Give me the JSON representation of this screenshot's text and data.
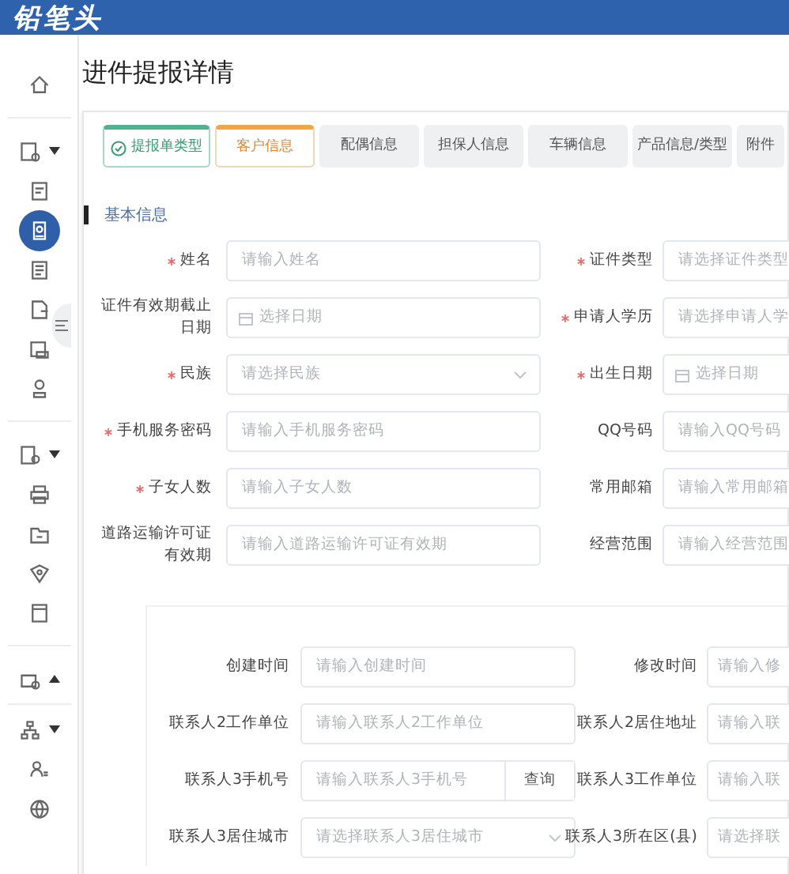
{
  "header": {
    "logo": "铅笔头"
  },
  "sidebar": {
    "groups": [
      {
        "items": [
          {
            "selected": false
          }
        ]
      },
      {
        "items": [
          {
            "selected": false,
            "expanded": false
          },
          {
            "selected": false
          },
          {
            "selected": true
          },
          {
            "selected": false
          },
          {
            "selected": false
          },
          {
            "selected": false
          },
          {
            "selected": false
          }
        ]
      },
      {
        "items": [
          {
            "selected": false,
            "expanded": false
          },
          {
            "selected": false
          },
          {
            "selected": false
          },
          {
            "selected": false
          },
          {
            "selected": false
          }
        ]
      },
      {
        "items": [
          {
            "selected": false,
            "expanded": true
          }
        ]
      },
      {
        "items": [
          {
            "selected": false,
            "expanded": false
          },
          {
            "selected": false
          },
          {
            "selected": false
          }
        ]
      }
    ]
  },
  "page": {
    "title": "进件提报详情"
  },
  "tabs": [
    {
      "label": "提报单类型",
      "selected": false,
      "done": true
    },
    {
      "label": "客户信息",
      "selected": true,
      "done": false
    },
    {
      "label": "配偶信息",
      "selected": false,
      "done": false
    },
    {
      "label": "担保人信息",
      "selected": false,
      "done": false
    },
    {
      "label": "车辆信息",
      "selected": false,
      "done": false
    },
    {
      "label": "产品信息/类型",
      "selected": false,
      "done": false
    },
    {
      "label": "附件",
      "selected": false,
      "done": false
    }
  ],
  "section": {
    "title": "基本信息"
  },
  "form": {
    "rows": [
      [
        {
          "label": "姓名",
          "required": true,
          "kind": "input",
          "placeholder": "请输入姓名"
        },
        {
          "label": "证件类型",
          "required": true,
          "kind": "input",
          "placeholder": "请选择证件类型"
        }
      ],
      [
        {
          "label": "证件有效期截止日期",
          "required": false,
          "kind": "date",
          "placeholder": "选择日期"
        },
        {
          "label": "申请人学历",
          "required": true,
          "kind": "input",
          "placeholder": "请选择申请人学"
        }
      ],
      [
        {
          "label": "民族",
          "required": true,
          "kind": "select",
          "placeholder": "请选择民族"
        },
        {
          "label": "出生日期",
          "required": true,
          "kind": "date",
          "placeholder": "选择日期"
        }
      ],
      [
        {
          "label": "手机服务密码",
          "required": true,
          "kind": "input",
          "placeholder": "请输入手机服务密码"
        },
        {
          "label": "QQ号码",
          "required": false,
          "kind": "input",
          "placeholder": "请输入QQ号码"
        }
      ],
      [
        {
          "label": "子女人数",
          "required": true,
          "kind": "input",
          "placeholder": "请输入子女人数"
        },
        {
          "label": "常用邮箱",
          "required": false,
          "kind": "input",
          "placeholder": "请输入常用邮箱"
        }
      ],
      [
        {
          "label": "道路运输许可证有效期",
          "required": false,
          "kind": "input",
          "placeholder": "请输入道路运输许可证有效期"
        },
        {
          "label": "经营范围",
          "required": false,
          "kind": "input",
          "placeholder": "请输入经营范围"
        }
      ]
    ]
  },
  "contacts": {
    "rows": [
      [
        {
          "label": "创建时间",
          "kind": "input",
          "placeholder": "请输入创建时间"
        },
        {
          "label": "修改时间",
          "kind": "input",
          "placeholder": "请输入修"
        }
      ],
      [
        {
          "label": "联系人2工作单位",
          "kind": "input",
          "placeholder": "请输入联系人2工作单位"
        },
        {
          "label": "联系人2居住地址",
          "kind": "input",
          "placeholder": "请输入联"
        }
      ],
      [
        {
          "label": "联系人3手机号",
          "kind": "search",
          "placeholder": "请输入联系人3手机号",
          "button": "查询"
        },
        {
          "label": "联系人3工作单位",
          "kind": "input",
          "placeholder": "请输入联"
        }
      ],
      [
        {
          "label": "联系人3居住城市",
          "kind": "select",
          "placeholder": "请选择联系人3居住城市"
        },
        {
          "label": "联系人3所在区(县)",
          "kind": "input",
          "placeholder": "请选择联"
        }
      ]
    ]
  }
}
